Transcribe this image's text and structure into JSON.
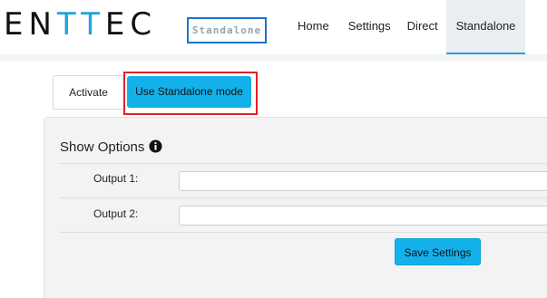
{
  "header": {
    "logo": {
      "part1": "EN",
      "part2": "TT",
      "part3": "EC"
    },
    "mode_badge": "Standalone",
    "nav": [
      {
        "label": "Home"
      },
      {
        "label": "Settings"
      },
      {
        "label": "Direct"
      },
      {
        "label": "Standalone",
        "active": true
      }
    ]
  },
  "tabs": {
    "activate_label": "Activate",
    "standalone_button_label": "Use Standalone mode"
  },
  "show_options": {
    "title": "Show Options",
    "info_icon": "info-circle-icon",
    "fields": [
      {
        "label": "Output 1:",
        "value": ""
      },
      {
        "label": "Output 2:",
        "value": ""
      }
    ],
    "save_label": "Save Settings"
  },
  "colors": {
    "accent": "#13b1ea",
    "logo_highlight": "#1fa5d6",
    "badge_border": "#1a75cf",
    "highlight_box": "#e0202a"
  }
}
